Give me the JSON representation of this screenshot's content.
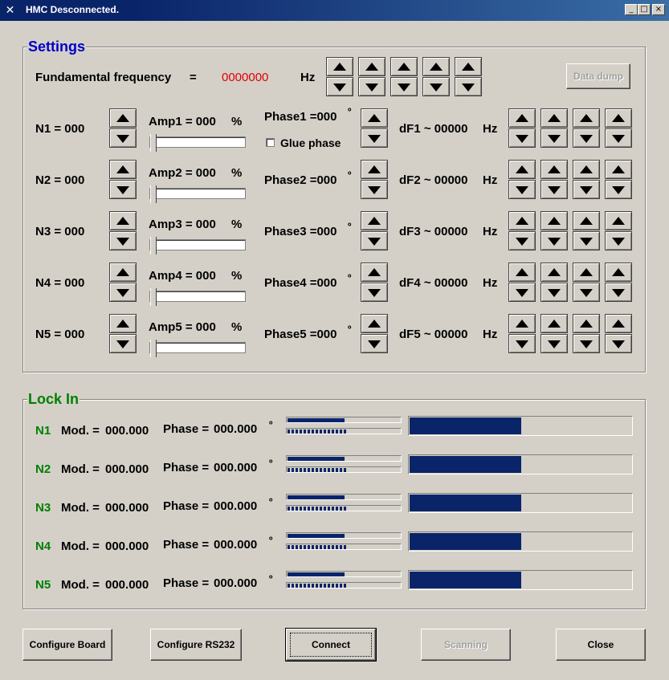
{
  "window": {
    "title": "HMC Desconnected.",
    "minimize": "_",
    "maximize": "□",
    "close": "×"
  },
  "settings": {
    "title": "Settings",
    "fundamental_label": "Fundamental frequency",
    "equals": "=",
    "fundamental_value": "0000000",
    "fundamental_unit": "Hz",
    "data_dump": "Data dump",
    "glue_phase": "Glue phase",
    "rows": [
      {
        "n": "N1 = 000",
        "amp": "Amp1 = 000",
        "amp_unit": "%",
        "phase": "Phase1 =000",
        "deg": "º",
        "df": "dF1 ~ 00000",
        "df_unit": "Hz",
        "amp_level": 0
      },
      {
        "n": "N2 = 000",
        "amp": "Amp2 = 000",
        "amp_unit": "%",
        "phase": "Phase2 =000",
        "deg": "º",
        "df": "dF2 ~ 00000",
        "df_unit": "Hz",
        "amp_level": 0
      },
      {
        "n": "N3 = 000",
        "amp": "Amp3 = 000",
        "amp_unit": "%",
        "phase": "Phase3 =000",
        "deg": "º",
        "df": "dF3 ~ 00000",
        "df_unit": "Hz",
        "amp_level": 0
      },
      {
        "n": "N4 = 000",
        "amp": "Amp4 = 000",
        "amp_unit": "%",
        "phase": "Phase4 =000",
        "deg": "º",
        "df": "dF4 ~ 00000",
        "df_unit": "Hz",
        "amp_level": 0
      },
      {
        "n": "N5 = 000",
        "amp": "Amp5 = 000",
        "amp_unit": "%",
        "phase": "Phase5 =000",
        "deg": "º",
        "df": "dF5 ~ 00000",
        "df_unit": "Hz",
        "amp_level": 0
      }
    ]
  },
  "lockin": {
    "title": "Lock In",
    "rows": [
      {
        "n": "N1",
        "mod_label": "Mod. =",
        "mod_value": "000.000",
        "phase_label": "Phase =",
        "phase_value": "000.000",
        "deg": "º",
        "mod_level": 0.5,
        "phase_level": 0.5
      },
      {
        "n": "N2",
        "mod_label": "Mod. =",
        "mod_value": "000.000",
        "phase_label": "Phase =",
        "phase_value": "000.000",
        "deg": "º",
        "mod_level": 0.5,
        "phase_level": 0.5
      },
      {
        "n": "N3",
        "mod_label": "Mod. =",
        "mod_value": "000.000",
        "phase_label": "Phase =",
        "phase_value": "000.000",
        "deg": "º",
        "mod_level": 0.5,
        "phase_level": 0.5
      },
      {
        "n": "N4",
        "mod_label": "Mod. =",
        "mod_value": "000.000",
        "phase_label": "Phase =",
        "phase_value": "000.000",
        "deg": "º",
        "mod_level": 0.5,
        "phase_level": 0.5
      },
      {
        "n": "N5",
        "mod_label": "Mod. =",
        "mod_value": "000.000",
        "phase_label": "Phase =",
        "phase_value": "000.000",
        "deg": "º",
        "mod_level": 0.5,
        "phase_level": 0.5
      }
    ]
  },
  "buttons": {
    "configure_board": "Configure Board",
    "configure_rs232": "Configure RS232",
    "connect": "Connect",
    "scanning": "Scanning",
    "close": "Close"
  },
  "colors": {
    "settings_title": "#0000c8",
    "lockin_title": "#008000",
    "lockin_n": "#008000",
    "fundamental_value": "#e00000",
    "progress": "#0a246a"
  },
  "icons": {
    "app": "app-icon",
    "spin_up": "arrow-up-icon",
    "spin_down": "arrow-down-icon"
  }
}
